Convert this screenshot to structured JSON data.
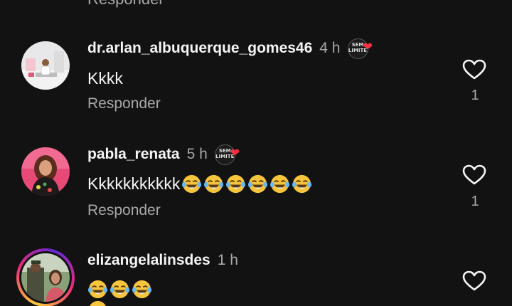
{
  "top_reply_label": "Responder",
  "comments": [
    {
      "username": "dr.arlan_albuquerque_gomes46",
      "time": "4 h",
      "text": "Kkkk",
      "reply_label": "Responder",
      "likes": "1",
      "creator_liked_badge": "SEM LIMITE"
    },
    {
      "username": "pabla_renata",
      "time": "5 h",
      "text": "Kkkkkkkkkkk",
      "reply_label": "Responder",
      "likes": "1",
      "creator_liked_badge": "SEM LIMITE"
    },
    {
      "username": "elizangelalinsdes",
      "time": "1 h",
      "text": ""
    }
  ],
  "colors": {
    "background": "#121212",
    "primary_text": "#f5f5f5",
    "secondary_text": "#a8a8a8",
    "heart_red": "#ff3040"
  },
  "icons": {
    "like": "heart-outline-icon",
    "liked_by_creator": "heart-filled-icon",
    "emoji": "tears-of-joy-emoji"
  }
}
